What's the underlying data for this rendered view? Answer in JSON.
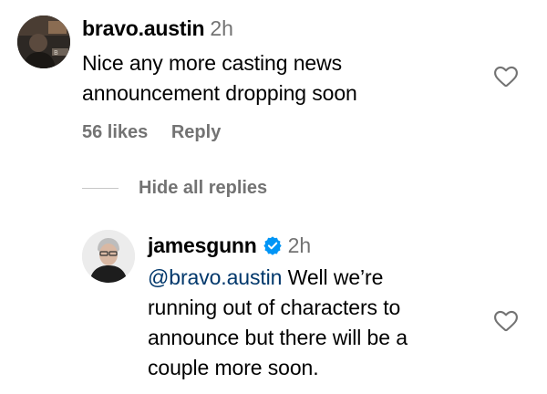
{
  "comment": {
    "username": "bravo.austin",
    "time": "2h",
    "text_line1": "Nice any more casting news",
    "text_line2": "announcement dropping soon",
    "likes": "56 likes",
    "reply_label": "Reply"
  },
  "hide_replies_label": "Hide all replies",
  "reply": {
    "username": "jamesgunn",
    "time": "2h",
    "mention": "@bravo.austin",
    "text_line1_rest": " Well we’re",
    "text_line2": "running out of characters to",
    "text_line3": "announce but there will be a",
    "text_line4": "couple more soon."
  },
  "colors": {
    "secondary_text": "#737373",
    "mention": "#00376b",
    "verified_badge": "#0095f6"
  },
  "icons": {
    "like": "heart-outline-icon",
    "verified": "verified-badge-icon"
  }
}
